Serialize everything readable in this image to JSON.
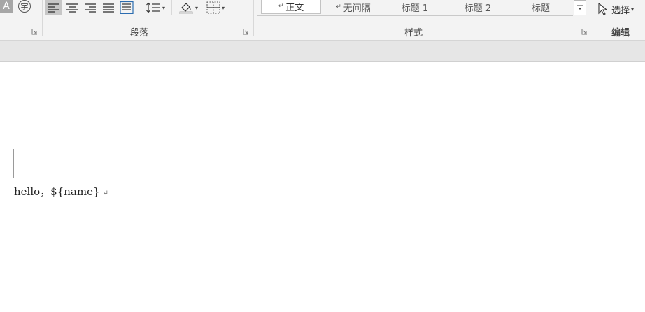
{
  "ribbon": {
    "font_group": {
      "a_glyph": "A",
      "zi_glyph": "字"
    },
    "paragraph_group": {
      "label": "段落"
    },
    "styles_group": {
      "label": "样式",
      "items": [
        {
          "mark": "↵",
          "text": "正文",
          "selected": true
        },
        {
          "mark": "↵",
          "text": "无间隔",
          "selected": false
        },
        {
          "mark": "",
          "text": "标题 1",
          "selected": false
        },
        {
          "mark": "",
          "text": "标题 2",
          "selected": false
        },
        {
          "mark": "",
          "text": "标题",
          "selected": false
        }
      ]
    },
    "editing_group": {
      "label": "编辑",
      "select_label": "选择"
    }
  },
  "document": {
    "text": "hello，${name}",
    "paragraph_mark": "↵"
  }
}
